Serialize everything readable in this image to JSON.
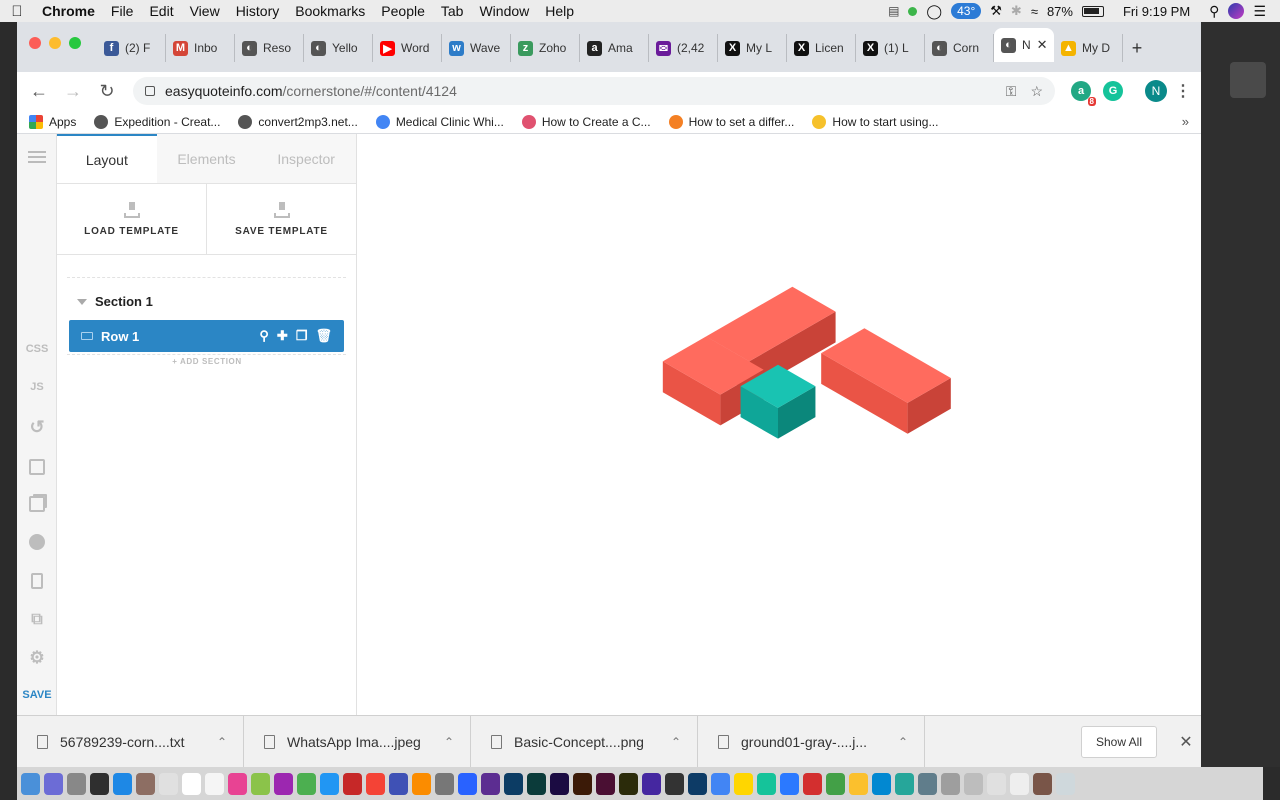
{
  "menubar": {
    "app_name": "Chrome",
    "menus": [
      "File",
      "Edit",
      "View",
      "History",
      "Bookmarks",
      "People",
      "Tab",
      "Window",
      "Help"
    ],
    "weather": "43°",
    "battery": "87%",
    "clock": "Fri 9:19 PM"
  },
  "browser": {
    "tabs": [
      {
        "label": "(2) F",
        "icon": "facebook-icon",
        "color": "#3b5998",
        "glyph": "f"
      },
      {
        "label": "Inbo",
        "icon": "gmail-icon",
        "color": "#d44638",
        "glyph": "M"
      },
      {
        "label": "Reso",
        "icon": "globe-icon",
        "color": "#555555",
        "glyph": "◐"
      },
      {
        "label": "Yello",
        "icon": "globe-icon",
        "color": "#555555",
        "glyph": "◐"
      },
      {
        "label": "Word",
        "icon": "youtube-icon",
        "color": "#ff0000",
        "glyph": "▶"
      },
      {
        "label": "Wave",
        "icon": "wave-icon",
        "color": "#2d7cc8",
        "glyph": "w"
      },
      {
        "label": "Zoho",
        "icon": "zoho-icon",
        "color": "#3a9a5e",
        "glyph": "z"
      },
      {
        "label": "Ama",
        "icon": "amazon-icon",
        "color": "#222222",
        "glyph": "a"
      },
      {
        "label": "(2,42",
        "icon": "mail-icon",
        "color": "#6a1b9a",
        "glyph": "✉"
      },
      {
        "label": "My L",
        "icon": "x-icon",
        "color": "#111111",
        "glyph": "X"
      },
      {
        "label": "Licen",
        "icon": "x-icon",
        "color": "#111111",
        "glyph": "X"
      },
      {
        "label": "(1) L",
        "icon": "x-icon",
        "color": "#111111",
        "glyph": "X"
      },
      {
        "label": "Corn",
        "icon": "globe-icon",
        "color": "#555555",
        "glyph": "◐"
      },
      {
        "label": "N",
        "icon": "globe-icon",
        "color": "#555555",
        "glyph": "◐",
        "active": true
      },
      {
        "label": "My D",
        "icon": "drive-icon",
        "color": "#f4b400",
        "glyph": "▲"
      }
    ],
    "url_host": "easyquoteinfo.com",
    "url_path": "/cornerstone/#/content/4124",
    "profile_initial": "N",
    "ext_badge": "8",
    "ext_a": "a",
    "ext_g": "G",
    "bookmarks": [
      {
        "label": "Apps",
        "icon": "apps-grid-icon",
        "color": "#e94235"
      },
      {
        "label": "Expedition - Creat...",
        "icon": "globe-icon",
        "color": "#555555"
      },
      {
        "label": "convert2mp3.net...",
        "icon": "globe-icon",
        "color": "#555555"
      },
      {
        "label": "Medical Clinic Whi...",
        "icon": "refresh-icon",
        "color": "#4285f4"
      },
      {
        "label": "How to Create a C...",
        "icon": "asterisk-icon",
        "color": "#e05270"
      },
      {
        "label": "How to set a differ...",
        "icon": "stackoverflow-icon",
        "color": "#f48024"
      },
      {
        "label": "How to start using...",
        "icon": "bookmark-logo-icon",
        "color": "#f6c12b"
      }
    ]
  },
  "app": {
    "rail": {
      "css": "CSS",
      "js": "JS",
      "save": "SAVE"
    },
    "panel_tabs": [
      "Layout",
      "Elements",
      "Inspector"
    ],
    "load_template": "LOAD TEMPLATE",
    "save_template": "SAVE TEMPLATE",
    "section_label": "Section 1",
    "row_label": "Row 1",
    "add_section": "+ ADD SECTION",
    "logo_colors": {
      "coral_top": "#ff6b5e",
      "coral_left": "#ea5446",
      "coral_right": "#c94338",
      "teal_top": "#19c3b2",
      "teal_left": "#0fa698",
      "teal_right": "#0b877b"
    }
  },
  "downloads": {
    "items": [
      "56789239-corn....txt",
      "WhatsApp Ima....jpeg",
      "Basic-Concept....png",
      "ground01-gray-....j..."
    ],
    "show_all": "Show All"
  }
}
